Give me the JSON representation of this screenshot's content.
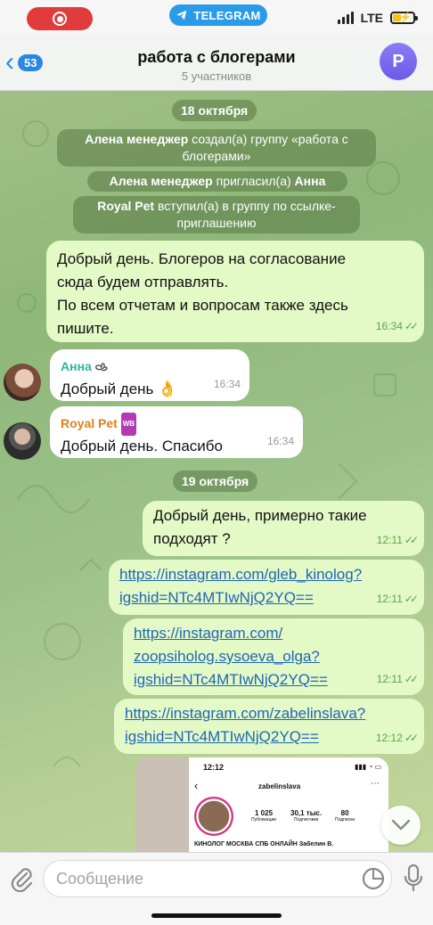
{
  "status": {
    "app_pill": "TELEGRAM",
    "network": "LTE"
  },
  "header": {
    "back_count": "53",
    "title": "работа с блогерами",
    "subtitle": "5 участников",
    "avatar_letter": "P"
  },
  "chat": {
    "date1": "18 октября",
    "service1_actor": "Алена менеджер",
    "service1_text": " создал(а) группу «работа с блогерами»",
    "service2_actor": "Алена менеджер",
    "service2_text": " пригласил(а) ",
    "service2_target": "Анна",
    "service3_actor": "Royal Pet",
    "service3_text": " вступил(а) в группу по ссылке-приглашению",
    "msg1_text_l1": "Добрый день. Блогеров на согласование",
    "msg1_text_l2": "сюда будем отправлять.",
    "msg1_text_l3": "По всем отчетам и вопросам также здесь",
    "msg1_text_l4": "пишите.",
    "msg1_time": "16:34",
    "msg2_sender": "Анна",
    "msg2_text": "Добрый день 👌",
    "msg2_time": "16:34",
    "msg3_sender": "Royal Pet",
    "msg3_badge": "WB",
    "msg3_text": "Добрый день. Спасибо",
    "msg3_time": "16:34",
    "date2": "19 октября",
    "msg4_l1": "Добрый день, примерно такие",
    "msg4_l2": "подходят ?",
    "msg4_time": "12:11",
    "msg5_l1": "https://instagram.com/gleb_kinolog?",
    "msg5_l2": "igshid=NTc4MTIwNjQ2YQ==",
    "msg5_time": "12:11",
    "msg6_l1": "https://instagram.com/",
    "msg6_l2": "zoopsiholog.sysoeva_olga?",
    "msg6_l3": "igshid=NTc4MTIwNjQ2YQ==",
    "msg6_time": "12:11",
    "msg7_l1": "https://instagram.com/zabelinslava?",
    "msg7_l2": "igshid=NTc4MTIwNjQ2YQ==",
    "msg7_time": "12:12"
  },
  "preview": {
    "time": "12:12",
    "username": "zabelinslava",
    "posts": "1 025",
    "posts_label": "Публикации",
    "followers": "30,1 тыс.",
    "followers_label": "Подписчики",
    "following": "80",
    "following_label": "Подписки",
    "bio": "КИНОЛОГ МОСКВА СПБ ОНЛАЙН Забелин В."
  },
  "input": {
    "placeholder": "Сообщение"
  },
  "colors": {
    "accent": "#2a88e0",
    "out_bubble": "#e3f9c6",
    "anna_name": "#2bb5a0",
    "royal_name": "#e0801c"
  }
}
